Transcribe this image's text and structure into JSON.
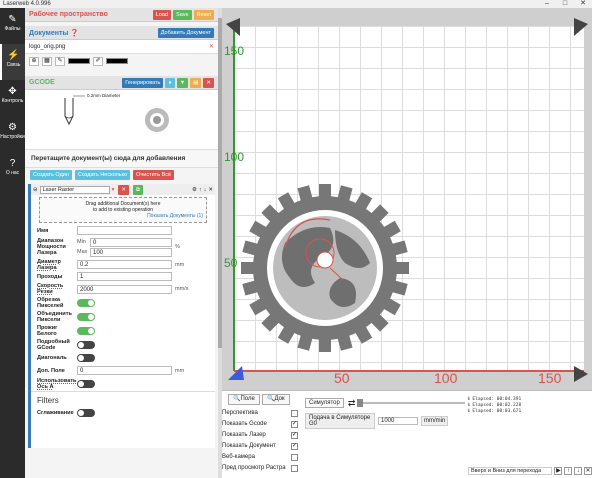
{
  "window": {
    "title": "Laserweb 4.0.996",
    "controls": [
      "–",
      "□",
      "✕"
    ]
  },
  "nav": [
    {
      "label": "Файлы",
      "icon": "pencil-icon"
    },
    {
      "label": "Связь",
      "icon": "plug-icon"
    },
    {
      "label": "Контроль",
      "icon": "move-arrows-icon"
    },
    {
      "label": "Настройки",
      "icon": "gears-icon"
    },
    {
      "label": "О нас",
      "icon": "question-icon"
    }
  ],
  "workspace": {
    "title": "Рабочее пространство",
    "load": "Load",
    "save": "Save",
    "reset": "Reset"
  },
  "documents": {
    "title": "Документы",
    "add": "Добавить Документ",
    "file": "logo_orig.png"
  },
  "gcode": {
    "title": "GCODE",
    "generate": "Генерировать",
    "tool_label": "0.2mm Diameter"
  },
  "drop_hint": "Перетащите документ(ы) сюда для добавления",
  "ops_buttons": {
    "create_single": "Создать Один",
    "create_multi": "Создать Несколько",
    "clear_all": "Очистить Всё"
  },
  "operation": {
    "type": "Laser Raster",
    "drag_hint_1": "Drag additional Document(s) here",
    "drag_hint_2": "to add to existing operation",
    "show_docs": "Показать Документы (1)",
    "fields": {
      "name": {
        "label": "Имя",
        "value": ""
      },
      "power_range": {
        "label": "Диапазон Мощности Лазера",
        "min_label": "Min",
        "min": "0",
        "max_label": "Max",
        "max": "100",
        "unit": "%"
      },
      "diameter": {
        "label": "Диаметр Лазера",
        "value": "0.2",
        "unit": "mm"
      },
      "passes": {
        "label": "Проходы",
        "value": "1"
      },
      "speed": {
        "label": "Скорость Резки",
        "value": "2000",
        "unit": "mm/s"
      },
      "trim": {
        "label": "Обрезка Пикселей",
        "on": true
      },
      "join": {
        "label": "Объединить Пиксели",
        "on": true
      },
      "burn_white": {
        "label": "Прожиг Белого",
        "on": true
      },
      "verbose": {
        "label": "Подробный GCode",
        "on": false
      },
      "diagonal": {
        "label": "Диагональ",
        "on": false
      },
      "extra": {
        "label": "Доп. Поле",
        "value": "0",
        "unit": "mm"
      },
      "use_a": {
        "label": "Использовать Ось A",
        "on": false
      }
    },
    "filters_title": "Filters",
    "smoothing": {
      "label": "Сглаживание",
      "on": false
    }
  },
  "canvas": {
    "x_ticks": [
      "50",
      "100",
      "150"
    ],
    "y_ticks": [
      "150",
      "100",
      "50"
    ]
  },
  "bottom": {
    "tabs": [
      "Поле",
      "Док"
    ],
    "options": [
      {
        "label": "Перспектива",
        "checked": false
      },
      {
        "label": "Показать Gcode",
        "checked": true
      },
      {
        "label": "Показать Лазер",
        "checked": true
      },
      {
        "label": "Показать Документ",
        "checked": true
      },
      {
        "label": "Веб-камера",
        "checked": false
      },
      {
        "label": "Пред просмотр Растра",
        "checked": false
      }
    ],
    "simulator_label": "Симулятор",
    "sim_feed_label": "Подача в Симуляторе G0",
    "sim_feed_value": "1000",
    "sim_feed_unit": "mm/min",
    "log": [
      "Elapsed: 00:04.391",
      "Elapsed: 00:02.228",
      "Elapsed: 00:03.671"
    ],
    "footer_hint": "Вверх и Вниз для перехода"
  },
  "colors": {
    "accent_red": "#d9534f",
    "accent_blue": "#337ab7",
    "accent_green": "#5cb85c",
    "axis_green": "#2e9a2e",
    "axis_red": "#d9534f"
  }
}
